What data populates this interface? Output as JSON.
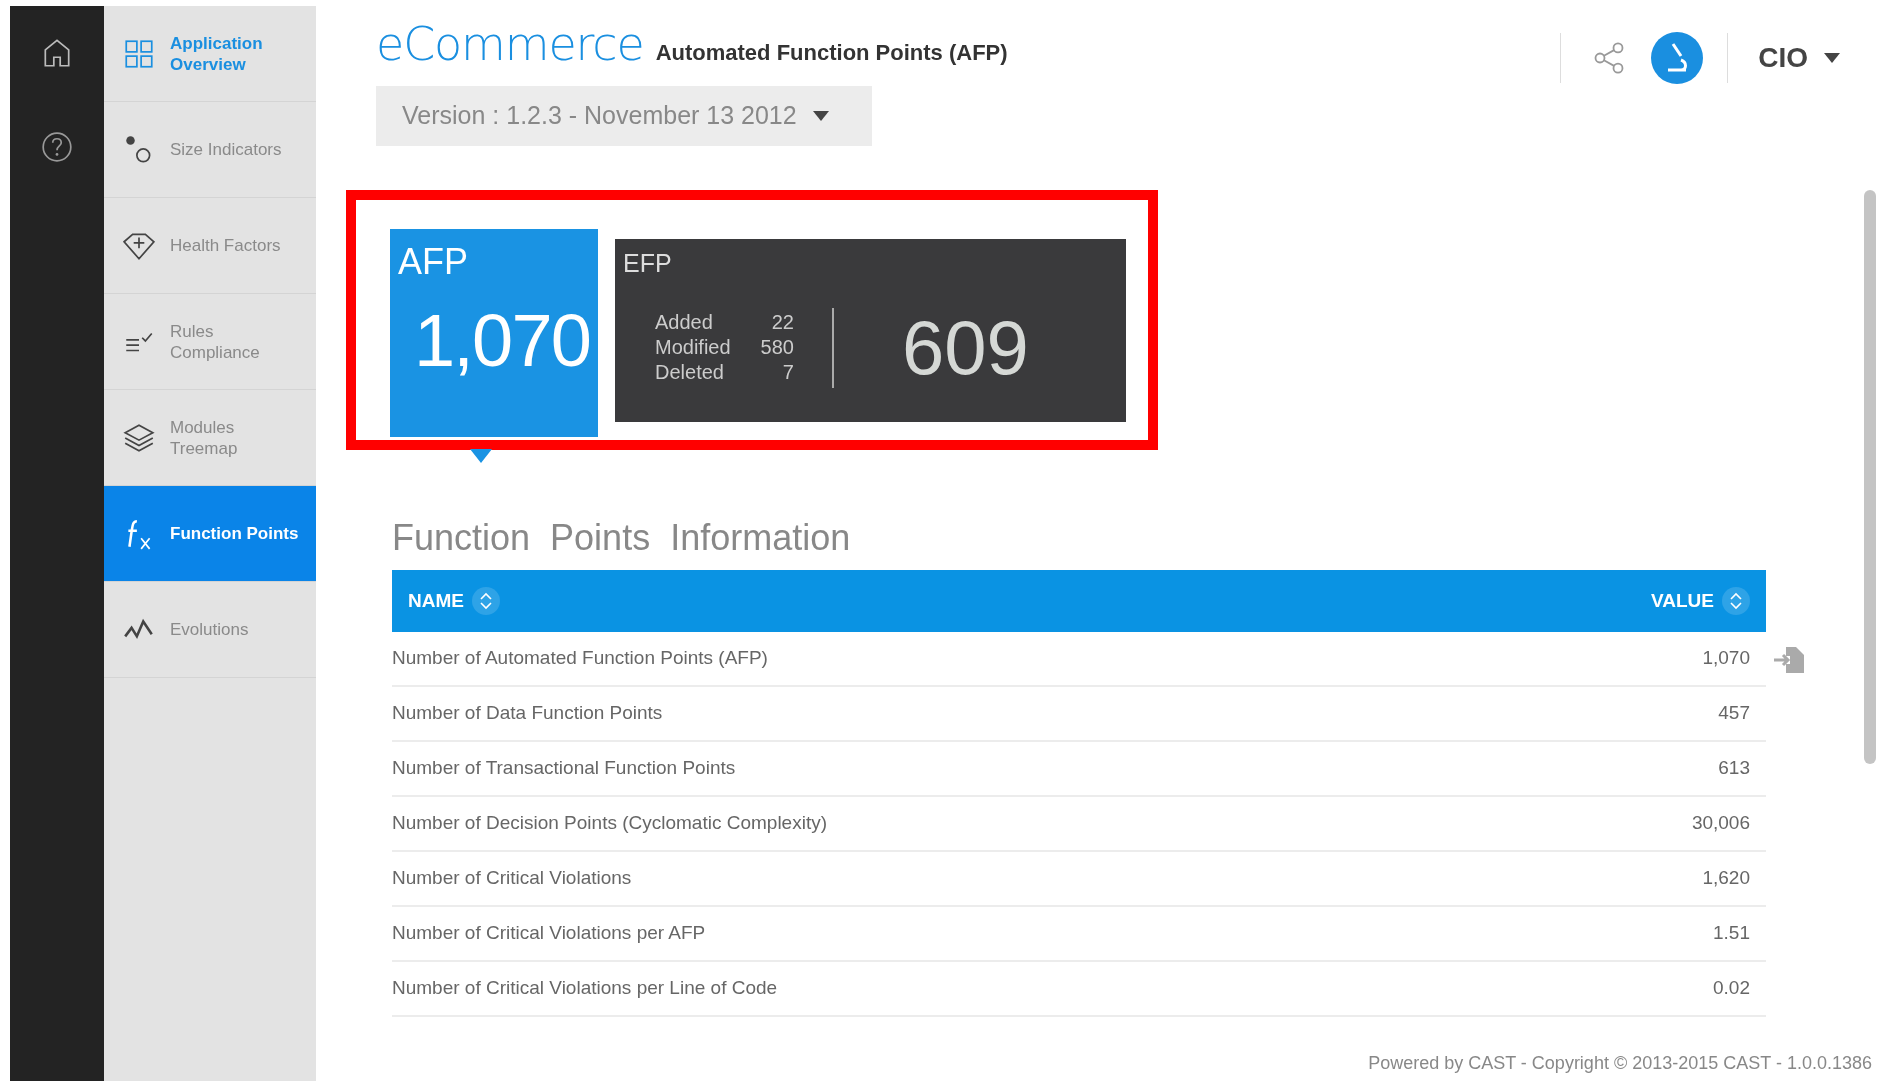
{
  "app": {
    "title": "eCommerce",
    "subtitle": "Automated Function Points (AFP)",
    "user": "CIO",
    "version": "Version : 1.2.3 - November 13 2012"
  },
  "sidebar": {
    "items": [
      {
        "label": "Application Overview",
        "kind": "header",
        "selected": false
      },
      {
        "label": "Size Indicators",
        "kind": "item",
        "selected": false
      },
      {
        "label": "Health Factors",
        "kind": "item",
        "selected": false
      },
      {
        "label": "Rules Compliance",
        "kind": "item",
        "selected": false
      },
      {
        "label": "Modules Treemap",
        "kind": "item",
        "selected": false
      },
      {
        "label": "Function Points",
        "kind": "item",
        "selected": true
      },
      {
        "label": "Evolutions",
        "kind": "item",
        "selected": false
      }
    ]
  },
  "tiles": {
    "afp": {
      "label": "AFP",
      "value": "1,070",
      "selected": true
    },
    "efp": {
      "label": "EFP",
      "value": "609",
      "details": [
        {
          "label": "Added",
          "value": "22"
        },
        {
          "label": "Modified",
          "value": "580"
        },
        {
          "label": "Deleted",
          "value": "7"
        }
      ]
    }
  },
  "table": {
    "title": "Function  Points  Information",
    "columns": [
      "NAME",
      "VALUE"
    ],
    "rows": [
      {
        "name": "Number of Automated Function Points (AFP)",
        "value": "1,070",
        "export": true
      },
      {
        "name": "Number of Data Function Points",
        "value": "457",
        "export": false
      },
      {
        "name": "Number of Transactional Function Points",
        "value": "613",
        "export": false
      },
      {
        "name": "Number of Decision Points (Cyclomatic Complexity)",
        "value": "30,006",
        "export": false
      },
      {
        "name": "Number of Critical Violations",
        "value": "1,620",
        "export": false
      },
      {
        "name": "Number of Critical Violations per AFP",
        "value": "1.51",
        "export": false
      },
      {
        "name": "Number of Critical Violations per Line of Code",
        "value": "0.02",
        "export": false
      }
    ]
  },
  "footer": "Powered by CAST - Copyright © 2013-2015 CAST - 1.0.0.1386"
}
